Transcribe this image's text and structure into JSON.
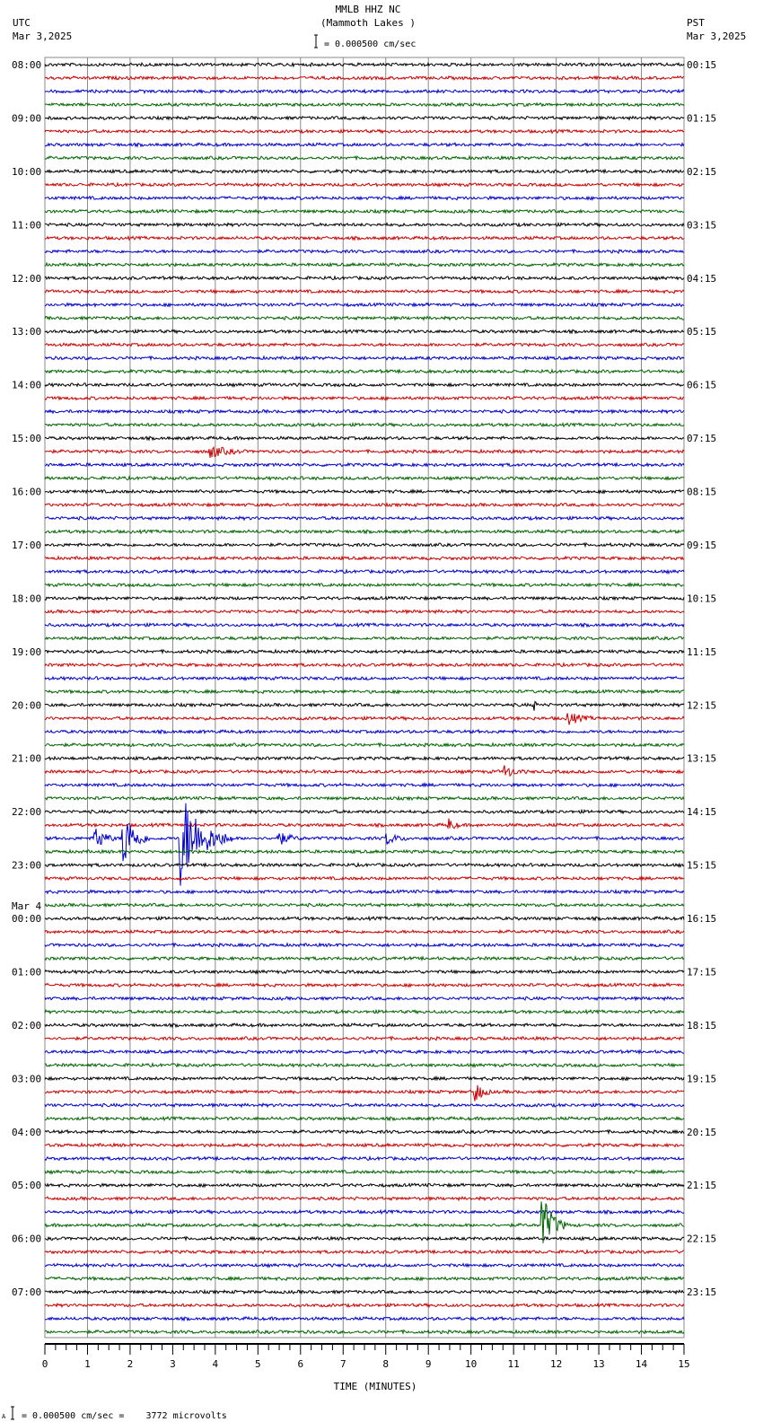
{
  "header": {
    "title": "MMLB HHZ NC",
    "subtitle": "(Mammoth Lakes )",
    "left_tz": "UTC",
    "left_date": "Mar 3,2025",
    "right_tz": "PST",
    "right_date": "Mar 3,2025",
    "scale": "= 0.000500 cm/sec"
  },
  "footer": {
    "scale": "= 0.000500 cm/sec =    3772 microvolts",
    "mark": "A"
  },
  "chart_data": {
    "type": "line",
    "title": "MMLB HHZ NC (Mammoth Lakes )",
    "xlabel": "TIME (MINUTES)",
    "xlim": [
      0,
      15
    ],
    "x_ticks": [
      "0",
      "1",
      "2",
      "3",
      "4",
      "5",
      "6",
      "7",
      "8",
      "9",
      "10",
      "11",
      "12",
      "13",
      "14",
      "15"
    ],
    "traces_per_hour": 4,
    "trace_colors": [
      "#000000",
      "#cc0000",
      "#0000cc",
      "#006400"
    ],
    "left_labels": [
      "08:00",
      "09:00",
      "10:00",
      "11:00",
      "12:00",
      "13:00",
      "14:00",
      "15:00",
      "16:00",
      "17:00",
      "18:00",
      "19:00",
      "20:00",
      "21:00",
      "22:00",
      "23:00",
      "00:00",
      "01:00",
      "02:00",
      "03:00",
      "04:00",
      "05:00",
      "06:00",
      "07:00"
    ],
    "day_change_label": "Mar 4",
    "right_labels": [
      "00:15",
      "01:15",
      "02:15",
      "03:15",
      "04:15",
      "05:15",
      "06:15",
      "07:15",
      "08:15",
      "09:15",
      "10:15",
      "11:15",
      "12:15",
      "13:15",
      "14:15",
      "15:15",
      "16:15",
      "17:15",
      "18:15",
      "19:15",
      "20:15",
      "21:15",
      "22:15",
      "23:15"
    ],
    "events": [
      {
        "trace": 58,
        "minute": 1.2,
        "amplitude": 1.0,
        "duration": 0.5
      },
      {
        "trace": 58,
        "minute": 1.85,
        "amplitude": 2.6,
        "duration": 0.6
      },
      {
        "trace": 58,
        "minute": 3.2,
        "amplitude": 3.8,
        "duration": 1.2
      },
      {
        "trace": 58,
        "minute": 5.5,
        "amplitude": 0.5,
        "duration": 0.6
      },
      {
        "trace": 58,
        "minute": 8.0,
        "amplitude": 0.5,
        "duration": 0.6
      },
      {
        "trace": 77,
        "minute": 10.1,
        "amplitude": 0.9,
        "duration": 0.4
      },
      {
        "trace": 87,
        "minute": 11.7,
        "amplitude": 2.2,
        "duration": 0.6
      },
      {
        "trace": 48,
        "minute": 11.5,
        "amplitude": 0.8,
        "duration": 0.05
      },
      {
        "trace": 29,
        "minute": 3.9,
        "amplitude": 0.5,
        "duration": 0.8
      },
      {
        "trace": 49,
        "minute": 12.3,
        "amplitude": 0.5,
        "duration": 0.6
      },
      {
        "trace": 53,
        "minute": 10.8,
        "amplitude": 0.5,
        "duration": 0.5
      },
      {
        "trace": 57,
        "minute": 9.5,
        "amplitude": 0.5,
        "duration": 0.3
      }
    ]
  }
}
